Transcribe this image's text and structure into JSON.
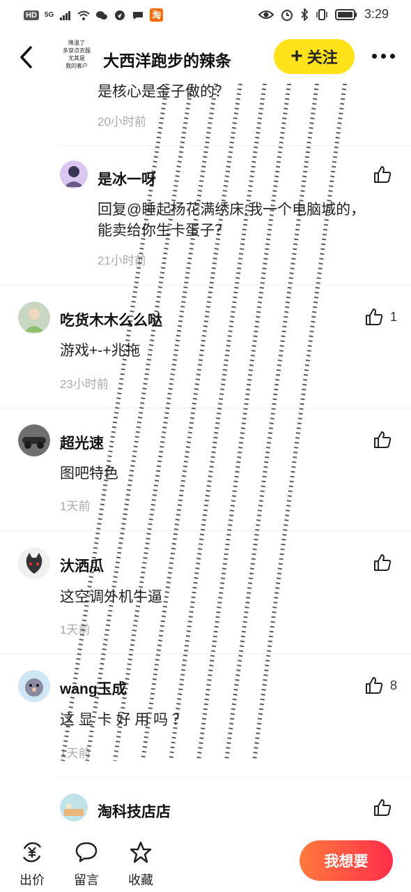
{
  "status_bar": {
    "hd": "HD",
    "net": "5G",
    "taobao_glyph": "淘",
    "time": "3:29"
  },
  "header": {
    "shop_logo_lines": [
      "降温了",
      "多穿点衣服",
      "尤其是",
      "我的客户"
    ],
    "title": "大西洋跑步的辣条",
    "follow_label": "关注",
    "follow_plus": "+",
    "accent_color": "#ffe21a"
  },
  "comments": [
    {
      "user": "",
      "text": "是核心是金子做的？",
      "time": "20小时前",
      "likes": ""
    },
    {
      "user": "是冰一呀",
      "text_line1": "回复@睡起杨花满绣床:我一个电脑城的，",
      "text_line2": "能卖给你生卡蛋子？",
      "time": "21小时前",
      "likes": ""
    },
    {
      "user": "吃货木木么么哒",
      "text": "游戏+-+兆拖",
      "time": "23小时前",
      "likes": "1"
    },
    {
      "user": "超光速",
      "text": "图吧特色",
      "time": "1天前",
      "likes": ""
    },
    {
      "user": "汏洒瓜",
      "text": "这空调外机牛逼",
      "time": "1天前",
      "likes": ""
    },
    {
      "user": "wang玉成",
      "text": "这 显 卡 好 用 吗 ？",
      "time": "1天前",
      "likes": "8"
    },
    {
      "user": "淘科技店店",
      "text": "",
      "time": "",
      "likes": ""
    }
  ],
  "bottom_bar": {
    "bid_label": "出价",
    "message_label": "留言",
    "favorite_label": "收藏",
    "want_label": "我想要"
  }
}
